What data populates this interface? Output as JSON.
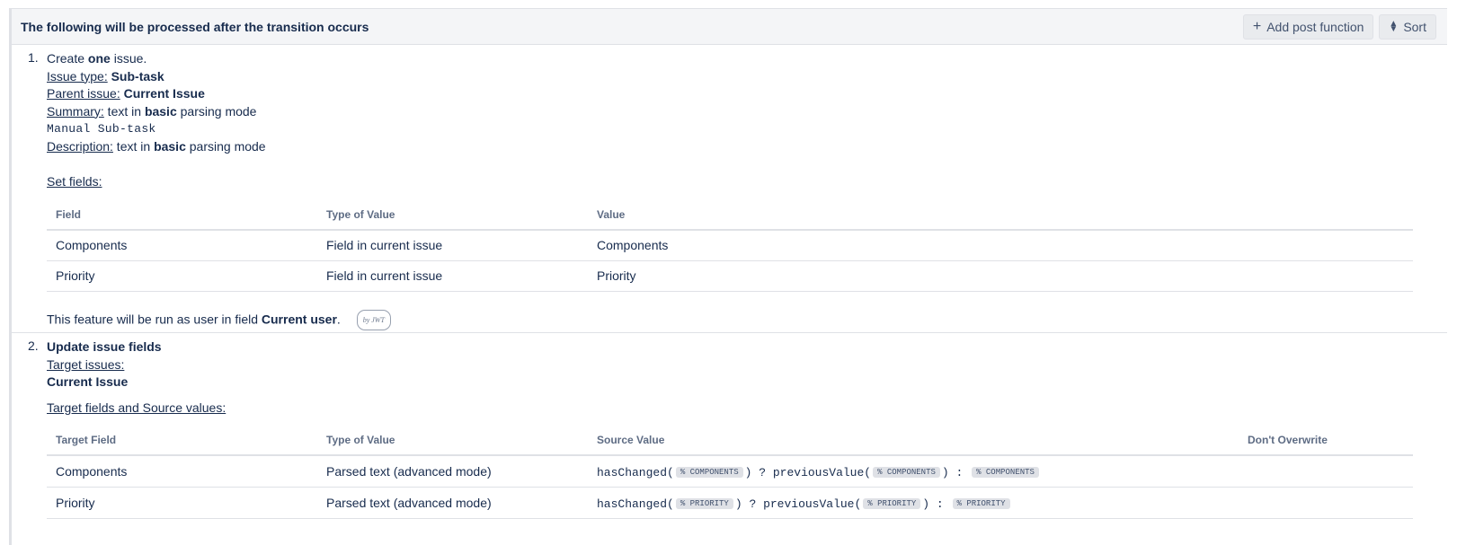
{
  "header": {
    "title": "The following will be processed after the transition occurs",
    "add_label": "Add post function",
    "sort_label": "Sort"
  },
  "pf1": {
    "number": "1.",
    "create_prefix": "Create ",
    "create_bold": "one",
    "create_suffix": " issue.",
    "issue_type_label": "Issue type:",
    "issue_type_value": "Sub-task",
    "parent_label": "Parent issue:",
    "parent_value": "Current Issue",
    "summary_label": "Summary:",
    "summary_text_prefix": " text in ",
    "summary_text_bold": "basic",
    "summary_text_suffix": " parsing mode",
    "summary_value": "Manual Sub-task",
    "description_label": "Description:",
    "description_text_prefix": " text in ",
    "description_text_bold": "basic",
    "description_text_suffix": " parsing mode",
    "set_fields_label": "Set fields:",
    "table": {
      "headers": [
        "Field",
        "Type of Value",
        "Value"
      ],
      "rows": [
        [
          "Components",
          "Field in current issue",
          "Components"
        ],
        [
          "Priority",
          "Field in current issue",
          "Priority"
        ]
      ]
    },
    "run_as_prefix": "This feature will be run as user in field ",
    "run_as_bold": "Current user",
    "run_as_suffix": ".",
    "badge": "by JWT"
  },
  "pf2": {
    "number": "2.",
    "title": "Update issue fields",
    "target_issues_label": "Target issues:",
    "target_issues_value": "Current Issue",
    "target_fields_label": "Target fields and Source values:",
    "table": {
      "headers": [
        "Target Field",
        "Type of Value",
        "Source Value",
        "Don't Overwrite"
      ],
      "rows": [
        {
          "field": "Components",
          "type": "Parsed text (advanced mode)",
          "fn1": "hasChanged(",
          "chip": "% COMPONENTS",
          "fn1_close": ")",
          "ternary": " ? ",
          "fn2": "previousValue(",
          "fn2_close": ")",
          "colon": " : "
        },
        {
          "field": "Priority",
          "type": "Parsed text (advanced mode)",
          "fn1": "hasChanged(",
          "chip": "% PRIORITY",
          "fn1_close": ")",
          "ternary": " ? ",
          "fn2": "previousValue(",
          "fn2_close": ")",
          "colon": " : "
        }
      ]
    }
  }
}
